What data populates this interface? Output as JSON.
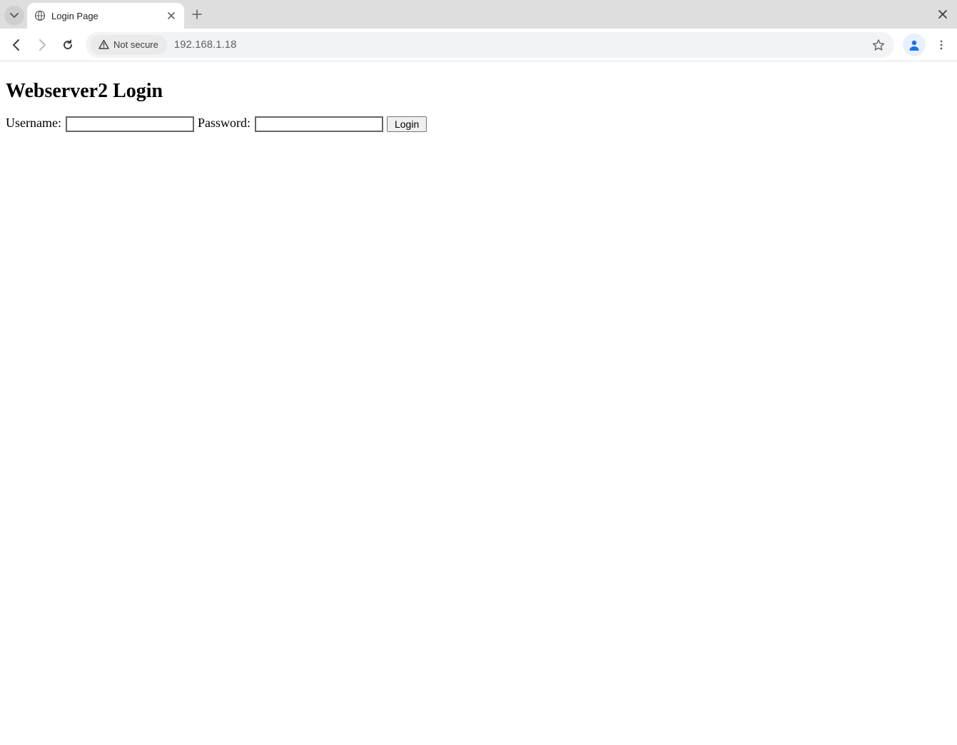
{
  "chrome": {
    "tab_title": "Login Page",
    "security_label": "Not secure",
    "address": "192.168.1.18"
  },
  "page": {
    "heading": "Webserver2 Login",
    "username_label": "Username:",
    "password_label": "Password:",
    "login_button_label": "Login",
    "username_value": "",
    "password_value": ""
  }
}
